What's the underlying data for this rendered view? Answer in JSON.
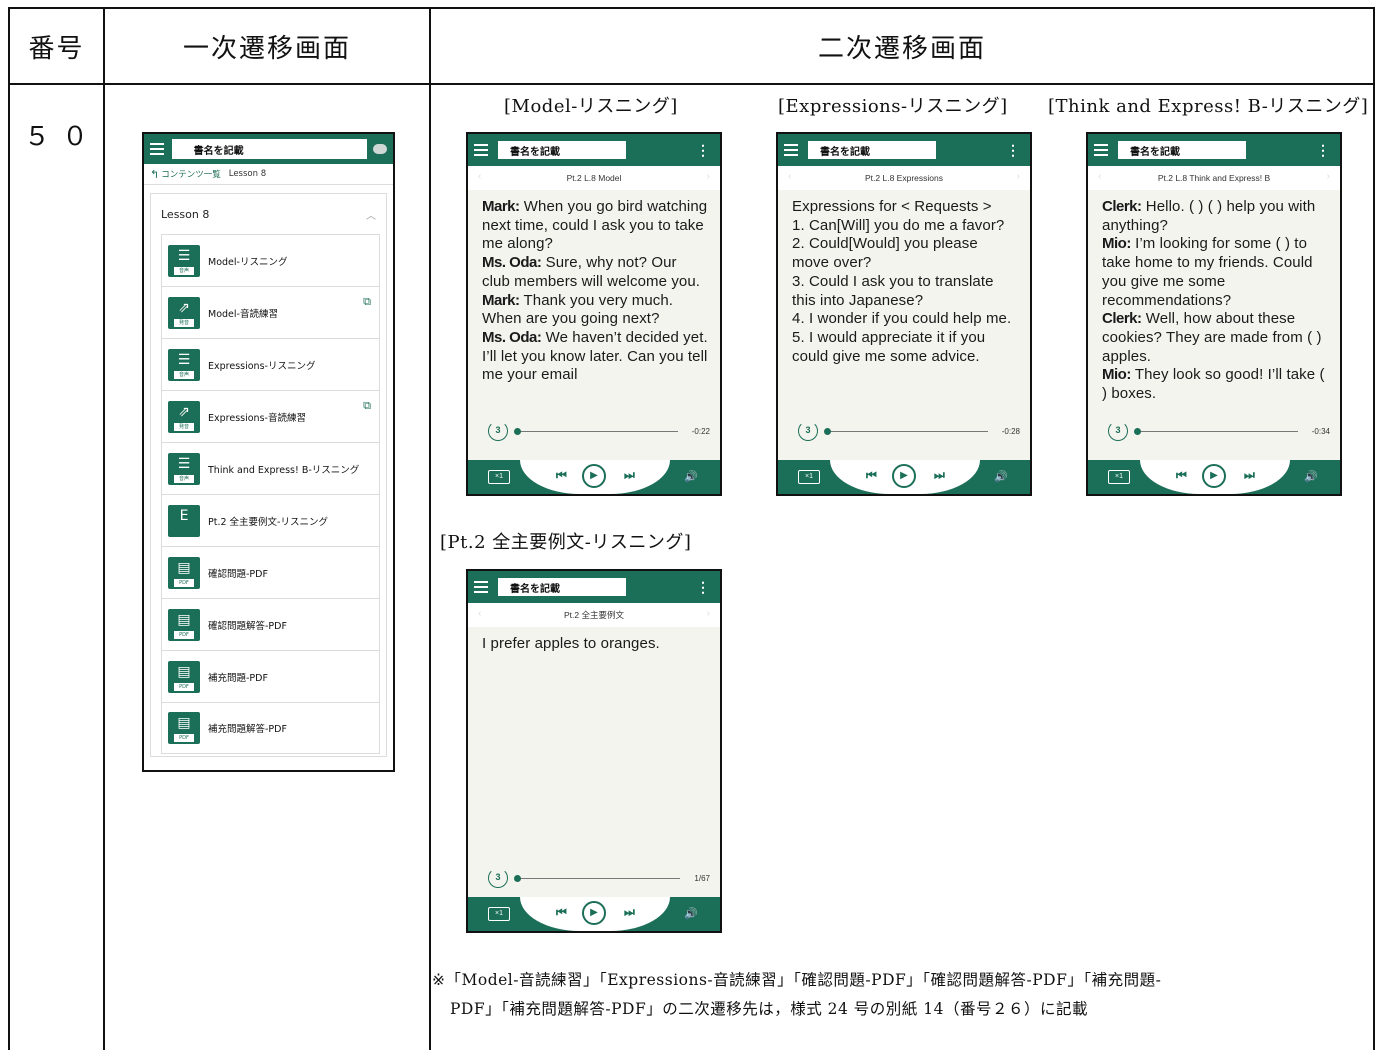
{
  "header": {
    "col_number": "番号",
    "col_primary": "一次遷移画面",
    "col_secondary": "二次遷移画面"
  },
  "row": {
    "number": "５０"
  },
  "primary": {
    "title": "書名を記載",
    "breadcrumb_back": "コンテンツ一覧",
    "breadcrumb_current": "Lesson 8",
    "panel_title": "Lesson 8",
    "items": [
      {
        "label": "Model-リスニング",
        "tag": "音声",
        "icon": "audio-icon",
        "external": false
      },
      {
        "label": "Model-音読練習",
        "tag": "発音",
        "icon": "external-link-box-icon",
        "external": true
      },
      {
        "label": "Expressions-リスニング",
        "tag": "音声",
        "icon": "audio-icon",
        "external": false
      },
      {
        "label": "Expressions-音読練習",
        "tag": "発音",
        "icon": "external-link-box-icon",
        "external": true
      },
      {
        "label": "Think and Express! B-リスニング",
        "tag": "音声",
        "icon": "audio-icon",
        "external": false
      },
      {
        "label": "Pt.2 全主要例文-リスニング",
        "tag": "",
        "icon": "english-audio-icon",
        "external": false
      },
      {
        "label": "確認問題-PDF",
        "tag": "PDF",
        "icon": "pdf-icon",
        "external": false
      },
      {
        "label": "確認問題解答-PDF",
        "tag": "PDF",
        "icon": "pdf-icon",
        "external": false
      },
      {
        "label": "補充問題-PDF",
        "tag": "PDF",
        "icon": "pdf-icon",
        "external": false
      },
      {
        "label": "補充問題解答-PDF",
        "tag": "PDF",
        "icon": "pdf-icon",
        "external": false
      }
    ]
  },
  "screens": [
    {
      "label": "[Model-リスニング]",
      "title": "書名を記載",
      "subtitle": "Pt.2 L.8 Model",
      "time": "-0:22",
      "lines": [
        {
          "speaker": "Mark:",
          "text": " When you go bird watching next time, could I ask you to take me along?"
        },
        {
          "speaker": "Ms. Oda:",
          "text": " Sure, why not?   Our club members will welcome you."
        },
        {
          "speaker": "Mark:",
          "text": " Thank you very much.  When are you going next?"
        },
        {
          "speaker": "Ms. Oda:",
          "text": " We haven’t decided yet.   I’ll let you know later.  Can you tell me your email"
        }
      ]
    },
    {
      "label": "[Expressions-リスニング]",
      "title": "書名を記載",
      "subtitle": "Pt.2 L.8 Expressions",
      "time": "-0:28",
      "lines": [
        {
          "speaker": "",
          "text": "Expressions for < Requests >"
        },
        {
          "speaker": "",
          "text": "1. Can[Will] you do me a favor?"
        },
        {
          "speaker": "",
          "text": "2. Could[Would] you please move over?"
        },
        {
          "speaker": "",
          "text": "3. Could I ask you to translate this into Japanese?"
        },
        {
          "speaker": "",
          "text": "4. I wonder if you could help me."
        },
        {
          "speaker": "",
          "text": "5. I would appreciate it if you could give me some advice."
        }
      ]
    },
    {
      "label": "[Think and Express! B-リスニング]",
      "title": "書名を記載",
      "subtitle": "Pt.2 L.8 Think and Express! B",
      "time": "-0:34",
      "lines": [
        {
          "speaker": "Clerk:",
          "text": " Hello.  (    ) (    ) help you with anything?"
        },
        {
          "speaker": "Mio:",
          "text": " I’m looking for some (    ) to take home to my friends.   Could you give me some recommendations?"
        },
        {
          "speaker": "Clerk:",
          "text": " Well, how about these cookies?   They are made from (    ) apples."
        },
        {
          "speaker": "Mio:",
          "text": " They look so good!   I’ll take (    ) boxes."
        }
      ]
    },
    {
      "label": "[Pt.2 全主要例文-リスニング]",
      "title": "書名を記載",
      "subtitle": "Pt.2  全主要例文",
      "time": "1/67",
      "lines": [
        {
          "speaker": "",
          "text": "I prefer apples to oranges."
        }
      ]
    }
  ],
  "player": {
    "speed": "×1",
    "replay": "3"
  },
  "note": {
    "line1": "※「Model-音読練習」「Expressions-音読練習」「確認問題-PDF」「確認問題解答-PDF」「補充問題-",
    "line2": "PDF」「補充問題解答-PDF」の二次遷移先は，様式 24 号の別紙 14（番号２６）に記載"
  }
}
